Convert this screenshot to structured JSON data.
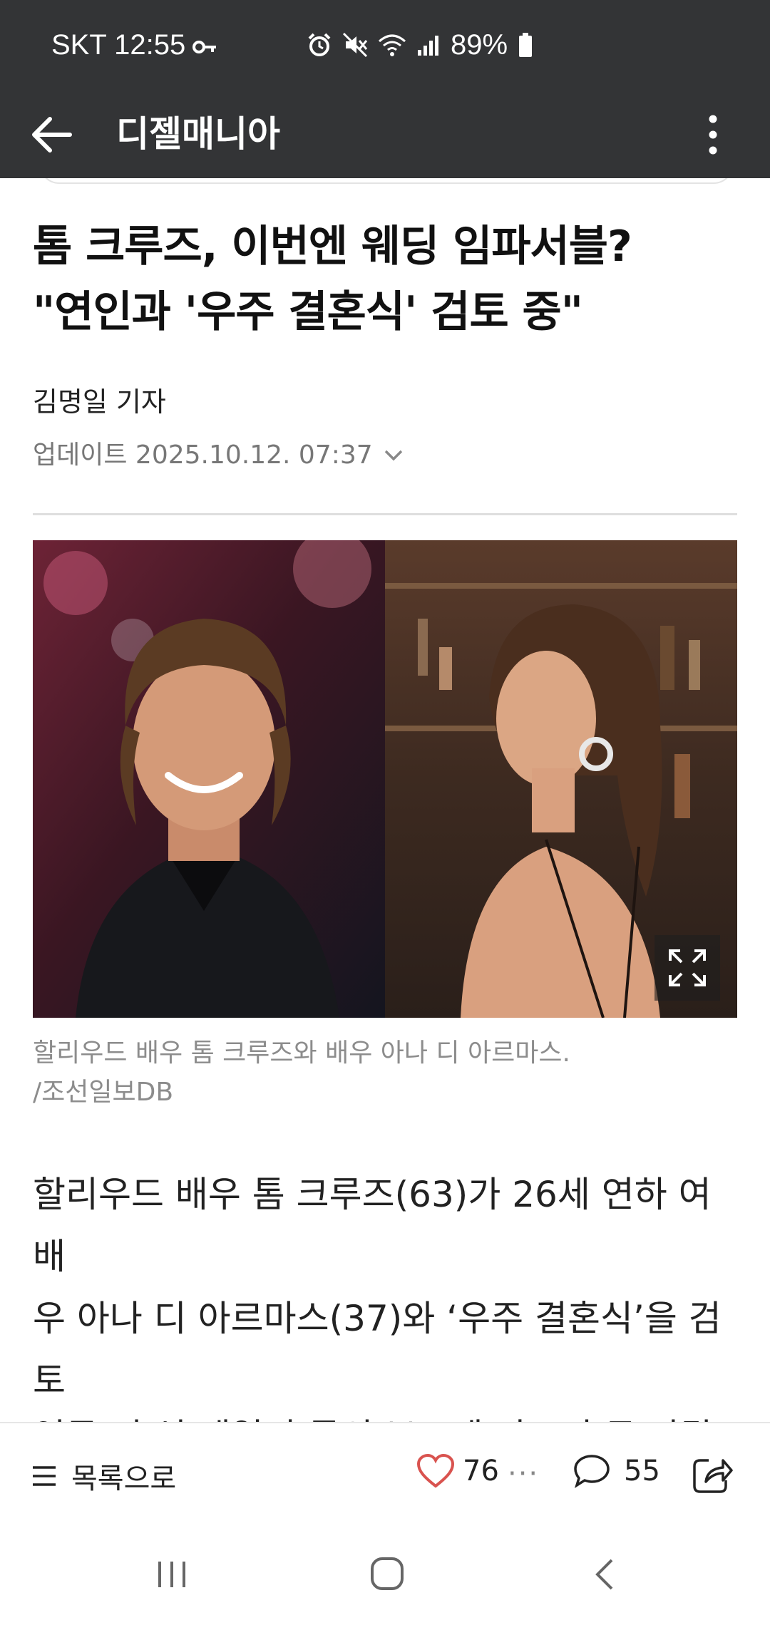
{
  "status_bar": {
    "carrier_time": "SKT 12:55",
    "battery": "89%",
    "icons": [
      "key-icon",
      "alarm-icon",
      "mute-icon",
      "wifi-icon",
      "signal-icon",
      "battery-icon"
    ]
  },
  "app_bar": {
    "title": "디젤매니아",
    "back_icon": "arrow-left-icon",
    "more_icon": "more-vertical-icon"
  },
  "article": {
    "headline": "톰 크루즈, 이번엔 웨딩 임파서블?\n\"연인과 '우주 결혼식' 검토 중\"",
    "byline": "김명일 기자",
    "updated": "업데이트 2025.10.12. 07:37",
    "photo_caption": "할리우드 배우 톰 크루즈와 배우 아나 디 아르마스.\n/조선일보DB",
    "body": "할리우드 배우 톰 크루즈(63)가 26세 연하 여배\n우 아나 디 아르마스(37)와 ‘우주 결혼식’을 검토\n중이라는 보도가 나왔다.",
    "next_line_partial": "영국 더 선 데일리 등의 보도에 따르면 두 사람은"
  },
  "action_bar": {
    "list_label": "목록으로",
    "like_count": "76",
    "comment_count": "55"
  },
  "colors": {
    "header_bg": "#333436",
    "like_red": "#d9534f",
    "caption_gray": "#8c8c8c"
  }
}
